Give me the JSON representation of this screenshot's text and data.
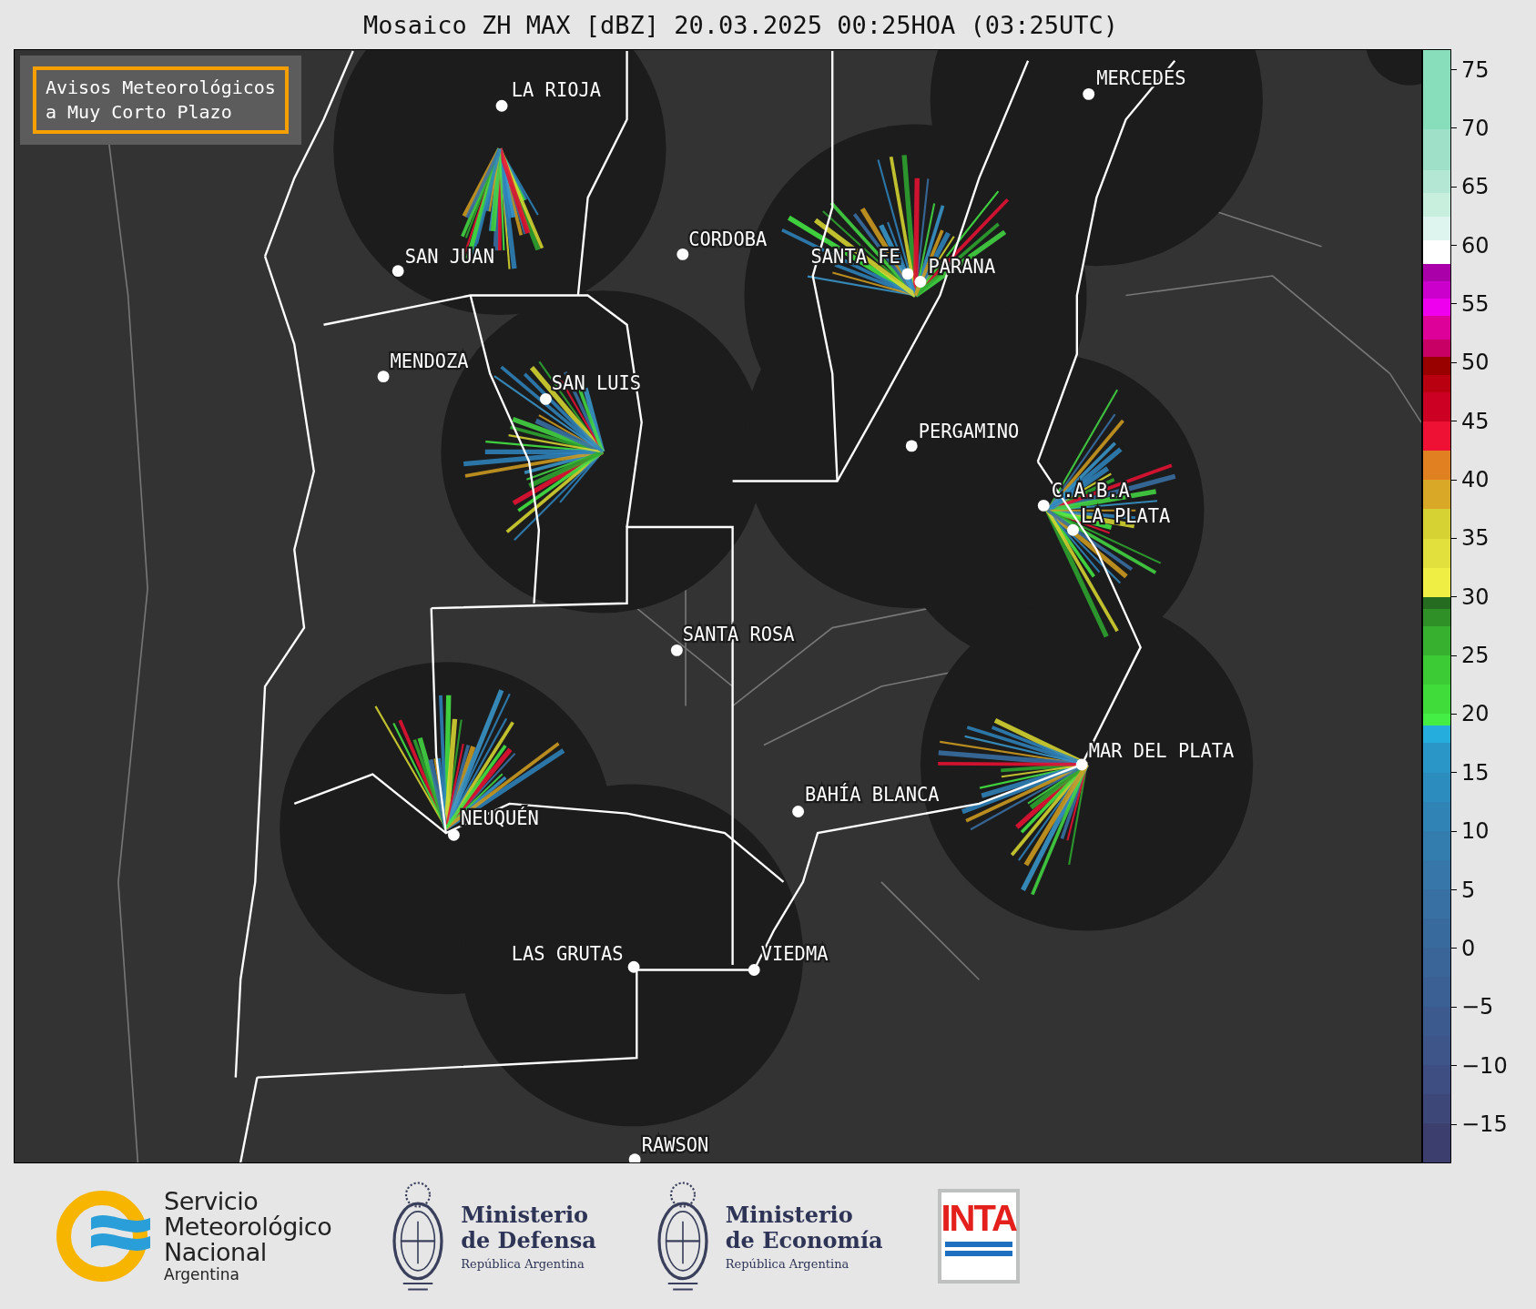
{
  "title": "Mosaico ZH MAX [dBZ] 20.03.2025 00:25HOA (03:25UTC)",
  "notice": {
    "lines": [
      "Avisos Meteorológicos",
      "a Muy Corto Plazo"
    ]
  },
  "map": {
    "cities": [
      {
        "name": "LA RIOJA"
      },
      {
        "name": "SAN JUAN"
      },
      {
        "name": "CORDOBA"
      },
      {
        "name": "SANTA FE"
      },
      {
        "name": "PARANA"
      },
      {
        "name": "MERCEDES"
      },
      {
        "name": "MENDOZA"
      },
      {
        "name": "SAN LUIS"
      },
      {
        "name": "PERGAMINO"
      },
      {
        "name": "C.A.B.A"
      },
      {
        "name": "LA PLATA"
      },
      {
        "name": "SANTA ROSA"
      },
      {
        "name": "MAR DEL PLATA"
      },
      {
        "name": "BAHÍA BLANCA"
      },
      {
        "name": "NEUQUÉN"
      },
      {
        "name": "LAS GRUTAS"
      },
      {
        "name": "VIEDMA"
      },
      {
        "name": "RAWSON"
      }
    ]
  },
  "colorbar": {
    "ticks": [
      "75",
      "70",
      "65",
      "60",
      "55",
      "50",
      "45",
      "40",
      "35",
      "30",
      "25",
      "20",
      "15",
      "10",
      "5",
      "0",
      "−5",
      "−10",
      "−15"
    ]
  },
  "footer": {
    "smn": {
      "lines": [
        "Servicio",
        "Meteorológico",
        "Nacional"
      ],
      "country": "Argentina"
    },
    "ministries": [
      {
        "lines": [
          "Ministerio",
          "de Defensa"
        ],
        "country": "República Argentina"
      },
      {
        "lines": [
          "Ministerio",
          "de Economía"
        ],
        "country": "República Argentina"
      }
    ],
    "inta": {
      "text": "INTA"
    }
  }
}
